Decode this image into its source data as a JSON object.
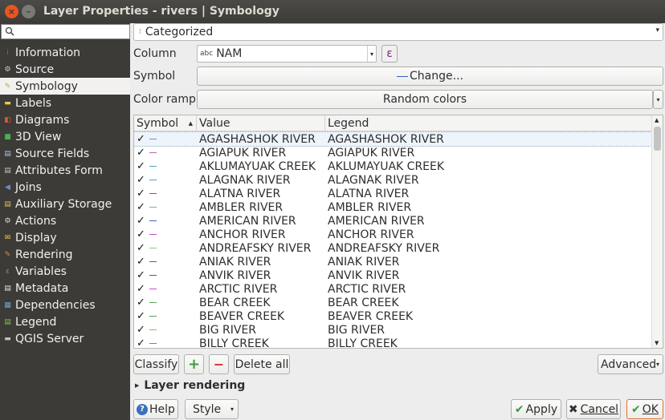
{
  "window": {
    "title": "Layer Properties - rivers | Symbology",
    "close_glyph": "×",
    "min_glyph": "–"
  },
  "sidebar": {
    "items": [
      {
        "label": "Information",
        "icon": "info-icon",
        "color": "#3a7bd5"
      },
      {
        "label": "Source",
        "icon": "source-icon",
        "color": "#cfcfcf"
      },
      {
        "label": "Symbology",
        "icon": "paintbrush-icon",
        "color": "#c9a34c",
        "active": true
      },
      {
        "label": "Labels",
        "icon": "labels-icon",
        "color": "#e8d050"
      },
      {
        "label": "Diagrams",
        "icon": "diagrams-icon",
        "color": "#e05a3a"
      },
      {
        "label": "3D View",
        "icon": "cube-icon",
        "color": "#4caf50"
      },
      {
        "label": "Source Fields",
        "icon": "fields-icon",
        "color": "#a0c0e0"
      },
      {
        "label": "Attributes Form",
        "icon": "form-icon",
        "color": "#c0c0c0"
      },
      {
        "label": "Joins",
        "icon": "joins-icon",
        "color": "#6a8fd0"
      },
      {
        "label": "Auxiliary Storage",
        "icon": "storage-icon",
        "color": "#d0c060"
      },
      {
        "label": "Actions",
        "icon": "actions-icon",
        "color": "#dcdcdc"
      },
      {
        "label": "Display",
        "icon": "display-icon",
        "color": "#f0d040"
      },
      {
        "label": "Rendering",
        "icon": "rendering-icon",
        "color": "#d09050"
      },
      {
        "label": "Variables",
        "icon": "variables-icon",
        "color": "#b070b0"
      },
      {
        "label": "Metadata",
        "icon": "metadata-icon",
        "color": "#e0e0e0"
      },
      {
        "label": "Dependencies",
        "icon": "dependencies-icon",
        "color": "#70a0d0"
      },
      {
        "label": "Legend",
        "icon": "legend-icon",
        "color": "#7fbf50"
      },
      {
        "label": "QGIS Server",
        "icon": "server-icon",
        "color": "#c0c0c0"
      }
    ]
  },
  "renderer": {
    "value": "Categorized"
  },
  "column": {
    "label": "Column",
    "type_badge": "abc",
    "value": "NAM",
    "expr_glyph": "ε"
  },
  "symbol": {
    "label": "Symbol",
    "button": "Change..."
  },
  "color_ramp": {
    "label": "Color ramp",
    "value": "Random colors"
  },
  "table": {
    "headers": [
      "Symbol",
      "Value",
      "Legend"
    ],
    "rows": [
      {
        "value": "AGASHASHOK RIVER",
        "legend": "AGASHASHOK RIVER",
        "color": "#50a0d0"
      },
      {
        "value": "AGIAPUK RIVER",
        "legend": "AGIAPUK RIVER",
        "color": "#c060c0"
      },
      {
        "value": "AKLUMAYUAK CREEK",
        "legend": "AKLUMAYUAK CREEK",
        "color": "#50a0d0"
      },
      {
        "value": "ALAGNAK RIVER",
        "legend": "ALAGNAK RIVER",
        "color": "#50a0d0"
      },
      {
        "value": "ALATNA RIVER",
        "legend": "ALATNA RIVER",
        "color": "#a040a0"
      },
      {
        "value": "AMBLER RIVER",
        "legend": "AMBLER RIVER",
        "color": "#70c070"
      },
      {
        "value": "AMERICAN RIVER",
        "legend": "AMERICAN RIVER",
        "color": "#4060c0"
      },
      {
        "value": "ANCHOR RIVER",
        "legend": "ANCHOR RIVER",
        "color": "#c050c0"
      },
      {
        "value": "ANDREAFSKY RIVER",
        "legend": "ANDREAFSKY RIVER",
        "color": "#80d080"
      },
      {
        "value": "ANIAK RIVER",
        "legend": "ANIAK RIVER",
        "color": "#a04080"
      },
      {
        "value": "ANVIK RIVER",
        "legend": "ANVIK RIVER",
        "color": "#9030b0"
      },
      {
        "value": "ARCTIC RIVER",
        "legend": "ARCTIC RIVER",
        "color": "#c050c0"
      },
      {
        "value": "BEAR CREEK",
        "legend": "BEAR CREEK",
        "color": "#50b050"
      },
      {
        "value": "BEAVER CREEK",
        "legend": "BEAVER CREEK",
        "color": "#50a060"
      },
      {
        "value": "BIG RIVER",
        "legend": "BIG RIVER",
        "color": "#d0a050"
      },
      {
        "value": "BILLY CREEK",
        "legend": "BILLY CREEK",
        "color": "#40b040"
      }
    ]
  },
  "actions": {
    "classify": "Classify",
    "add_glyph": "+",
    "remove_glyph": "−",
    "delete_all": "Delete all",
    "advanced": "Advanced"
  },
  "layer_rendering": {
    "label": "Layer rendering"
  },
  "footer": {
    "help": "Help",
    "style": "Style",
    "apply": "Apply",
    "cancel": "Cancel",
    "ok": "OK"
  }
}
